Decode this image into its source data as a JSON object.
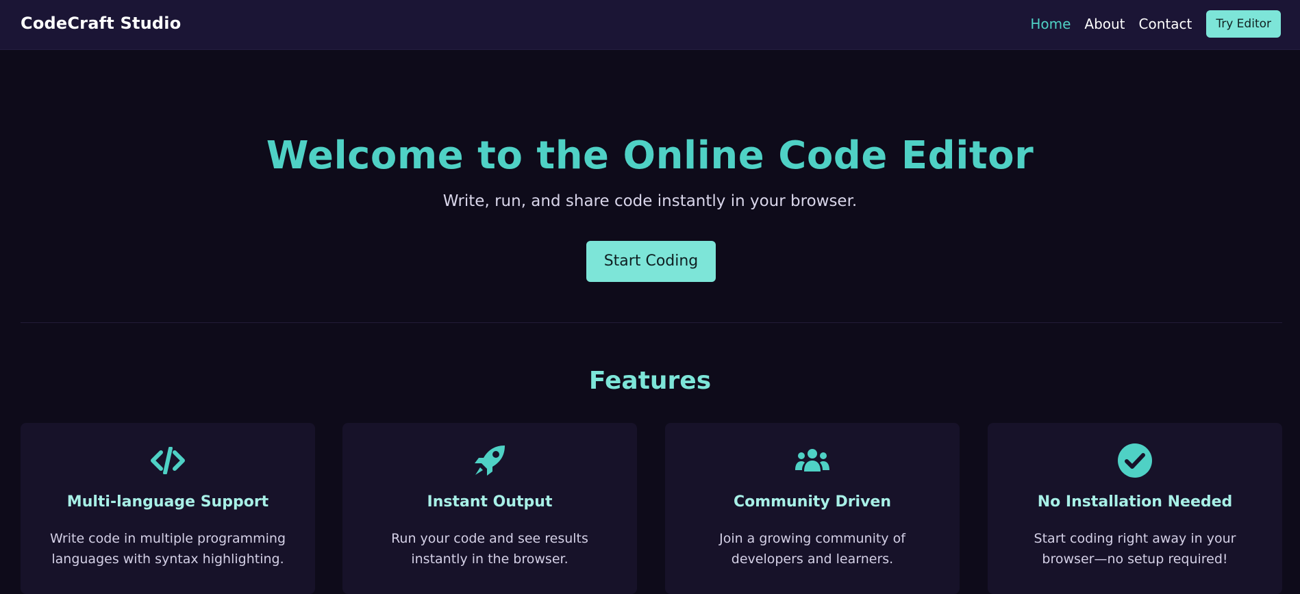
{
  "header": {
    "brand": "CodeCraft Studio",
    "nav": [
      {
        "label": "Home",
        "active": true
      },
      {
        "label": "About",
        "active": false
      },
      {
        "label": "Contact",
        "active": false
      }
    ],
    "cta_label": "Try Editor"
  },
  "hero": {
    "title": "Welcome to the Online Code Editor",
    "subtitle": "Write, run, and share code instantly in your browser.",
    "button_label": "Start Coding"
  },
  "features": {
    "title": "Features",
    "items": [
      {
        "icon": "code-icon",
        "title": "Multi-language Support",
        "description": "Write code in multiple programming languages with syntax highlighting."
      },
      {
        "icon": "rocket-icon",
        "title": "Instant Output",
        "description": "Run your code and see results instantly in the browser."
      },
      {
        "icon": "users-icon",
        "title": "Community Driven",
        "description": "Join a growing community of developers and learners."
      },
      {
        "icon": "check-circle-icon",
        "title": "No Installation Needed",
        "description": "Start coding right away in your browser—no setup required!"
      }
    ]
  },
  "colors": {
    "accent": "#4fd1c5",
    "accent_light": "#7de5d8",
    "background": "#0e0b1a",
    "header_bg": "#1b1535",
    "card_bg": "#171229"
  }
}
